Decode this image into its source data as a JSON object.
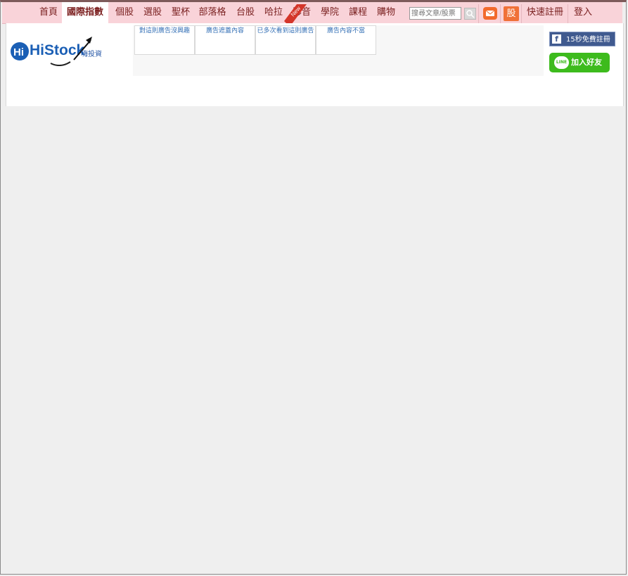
{
  "nav": {
    "items": [
      {
        "label": "首頁"
      },
      {
        "label": "國際指數"
      },
      {
        "label": "個股"
      },
      {
        "label": "選股"
      },
      {
        "label": "聖杯"
      },
      {
        "label": "部落格"
      },
      {
        "label": "台股"
      },
      {
        "label": "哈拉"
      },
      {
        "label": "影音"
      },
      {
        "label": "學院"
      },
      {
        "label": "課程"
      },
      {
        "label": "購物"
      }
    ],
    "new_badge": "New",
    "search_placeholder": "搜尋文章/股票",
    "search_icon": "search-icon",
    "mail_icon": "mail-icon",
    "stock_label": "股",
    "register": "快速註冊",
    "login": "登入"
  },
  "brand": {
    "logo_text": "HiStock",
    "logo_subtext": "嗨投資"
  },
  "ad_feedback": {
    "options": [
      {
        "label": "對這則廣告沒興趣"
      },
      {
        "label": "廣告遮蓋內容"
      },
      {
        "label": "已多次看到這則廣告"
      },
      {
        "label": "廣告內容不當"
      }
    ]
  },
  "social": {
    "facebook_label": "15秒免費註冊",
    "line_badge": "LINE",
    "line_label": "加入好友"
  },
  "colors": {
    "nav_bg": "#f9d3d9",
    "nav_text": "#7a2020",
    "accent_orange": "#f26a2d",
    "facebook_blue": "#405a8f",
    "line_green": "#3dbb1d",
    "link_blue": "#3470b6"
  }
}
